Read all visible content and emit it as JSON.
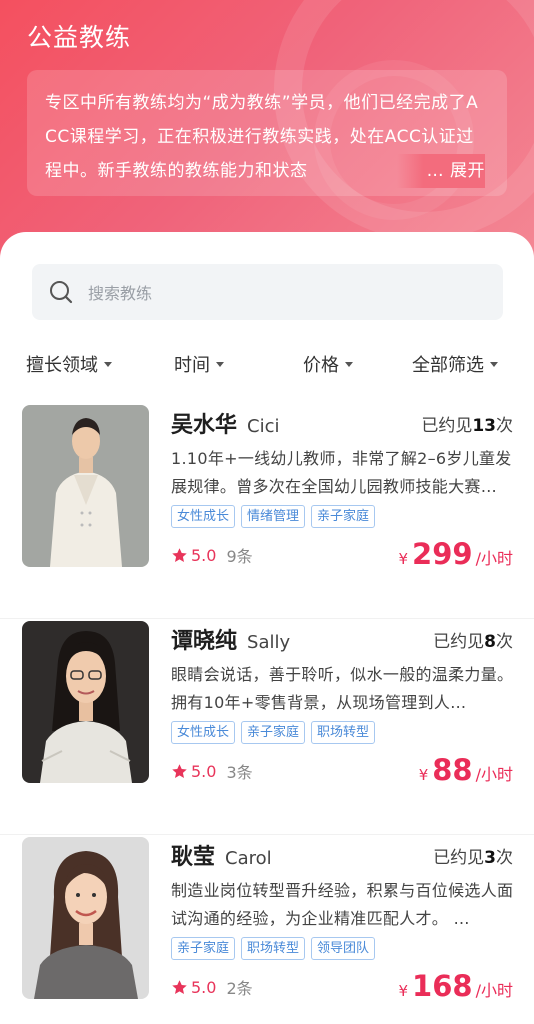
{
  "header": {
    "title": "公益教练",
    "intro": "专区中所有教练均为“成为教练”学员，他们已经完成了ACC课程学习，正在积极进行教练实践，处在ACC认证过程中。新手教练的教练能力和状态",
    "expand_label": "… 展开"
  },
  "search": {
    "placeholder": "搜索教练"
  },
  "filters": [
    {
      "label": "擅长领域"
    },
    {
      "label": "时间"
    },
    {
      "label": "价格"
    },
    {
      "label": "全部筛选"
    }
  ],
  "coaches": [
    {
      "name": "吴水华",
      "english_name": "Cici",
      "met_prefix": "已约见",
      "met_count": "13",
      "met_suffix": "次",
      "description": "1.10年+一线幼儿教师，非常了解2–6岁儿童发展规律。曾多次在全国幼儿园教师技能大赛…",
      "tags": [
        "女性成长",
        "情绪管理",
        "亲子家庭"
      ],
      "rating": "5.0",
      "reviews": "9条",
      "currency": "¥",
      "price": "299",
      "unit": "/小时"
    },
    {
      "name": "谭晓纯",
      "english_name": "Sally",
      "met_prefix": "已约见",
      "met_count": "8",
      "met_suffix": "次",
      "description": "眼睛会说话，善于聆听，似水一般的温柔力量。拥有10年+零售背景，从现场管理到人…",
      "tags": [
        "女性成长",
        "亲子家庭",
        "职场转型"
      ],
      "rating": "5.0",
      "reviews": "3条",
      "currency": "¥",
      "price": "88",
      "unit": "/小时"
    },
    {
      "name": "耿莹",
      "english_name": "Carol",
      "met_prefix": "已约见",
      "met_count": "3",
      "met_suffix": "次",
      "description": "制造业岗位转型晋升经验，积累与百位候选人面试沟通的经验，为企业精准匹配人才。 …",
      "tags": [
        "亲子家庭",
        "职场转型",
        "领导团队"
      ],
      "rating": "5.0",
      "reviews": "2条",
      "currency": "¥",
      "price": "168",
      "unit": "/小时"
    }
  ],
  "colors": {
    "brand_red": "#ea2d58",
    "header_gradient_start": "#f4505f",
    "tag_blue": "#4a8ad8"
  }
}
